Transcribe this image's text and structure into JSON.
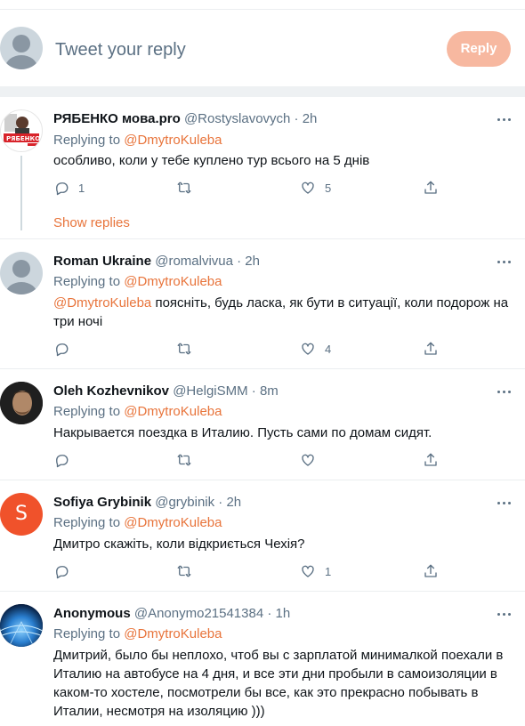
{
  "compose": {
    "placeholder": "Tweet your reply",
    "button_label": "Reply"
  },
  "replying_prefix": "Replying to",
  "show_replies": "Show replies",
  "tweets": [
    {
      "name": "РЯБЕНКО мова.pro",
      "handle": "@Rostyslavovych · 2h",
      "replying_to": "@DmytroKuleba",
      "text": "особливо, коли у тебе куплено тур всього на 5 днів",
      "text_mention": "",
      "replies": "1",
      "retweets": "",
      "likes": "5",
      "avatar_label": "РЯБЕНКО"
    },
    {
      "name": "Roman Ukraine",
      "handle": "@romalvivua · 2h",
      "replying_to": "@DmytroKuleba",
      "text_mention": "@DmytroKuleba",
      "text": " поясніть, будь ласка, як бути в ситуації, коли подорож на три ночі",
      "replies": "",
      "retweets": "",
      "likes": "4"
    },
    {
      "name": "Oleh Kozhevnikov",
      "handle": "@HelgiSMM · 8m",
      "replying_to": "@DmytroKuleba",
      "text_mention": "",
      "text": "Накрывается поездка в Италию. Пусть сами по домам сидят.",
      "replies": "",
      "retweets": "",
      "likes": ""
    },
    {
      "name": "Sofiya Grybinik",
      "handle": "@grybinik · 2h",
      "replying_to": "@DmytroKuleba",
      "text_mention": "",
      "text": "Дмитро скажіть, коли відкриється Чехія?",
      "replies": "",
      "retweets": "",
      "likes": "1",
      "avatar_letter": "S"
    },
    {
      "name": "Anonymous",
      "handle": "@Anonymo21541384 · 1h",
      "replying_to": "@DmytroKuleba",
      "text_mention": "",
      "text": "Дмитрий, было бы неплохо, чтоб вы с зарплатой минималкой поехали в Италию на автобусе на 4 дня, и все эти дни пробыли в самоизоляции в каком-то хостеле, посмотрели бы все, как это прекрасно побывать в Италии, несмотря на изоляцию )))"
    }
  ],
  "colors": {
    "accent": "#e8743b",
    "reply_button": "#f7b8a0",
    "muted": "#5b7083",
    "sofiya_avatar": "#f0522b"
  }
}
